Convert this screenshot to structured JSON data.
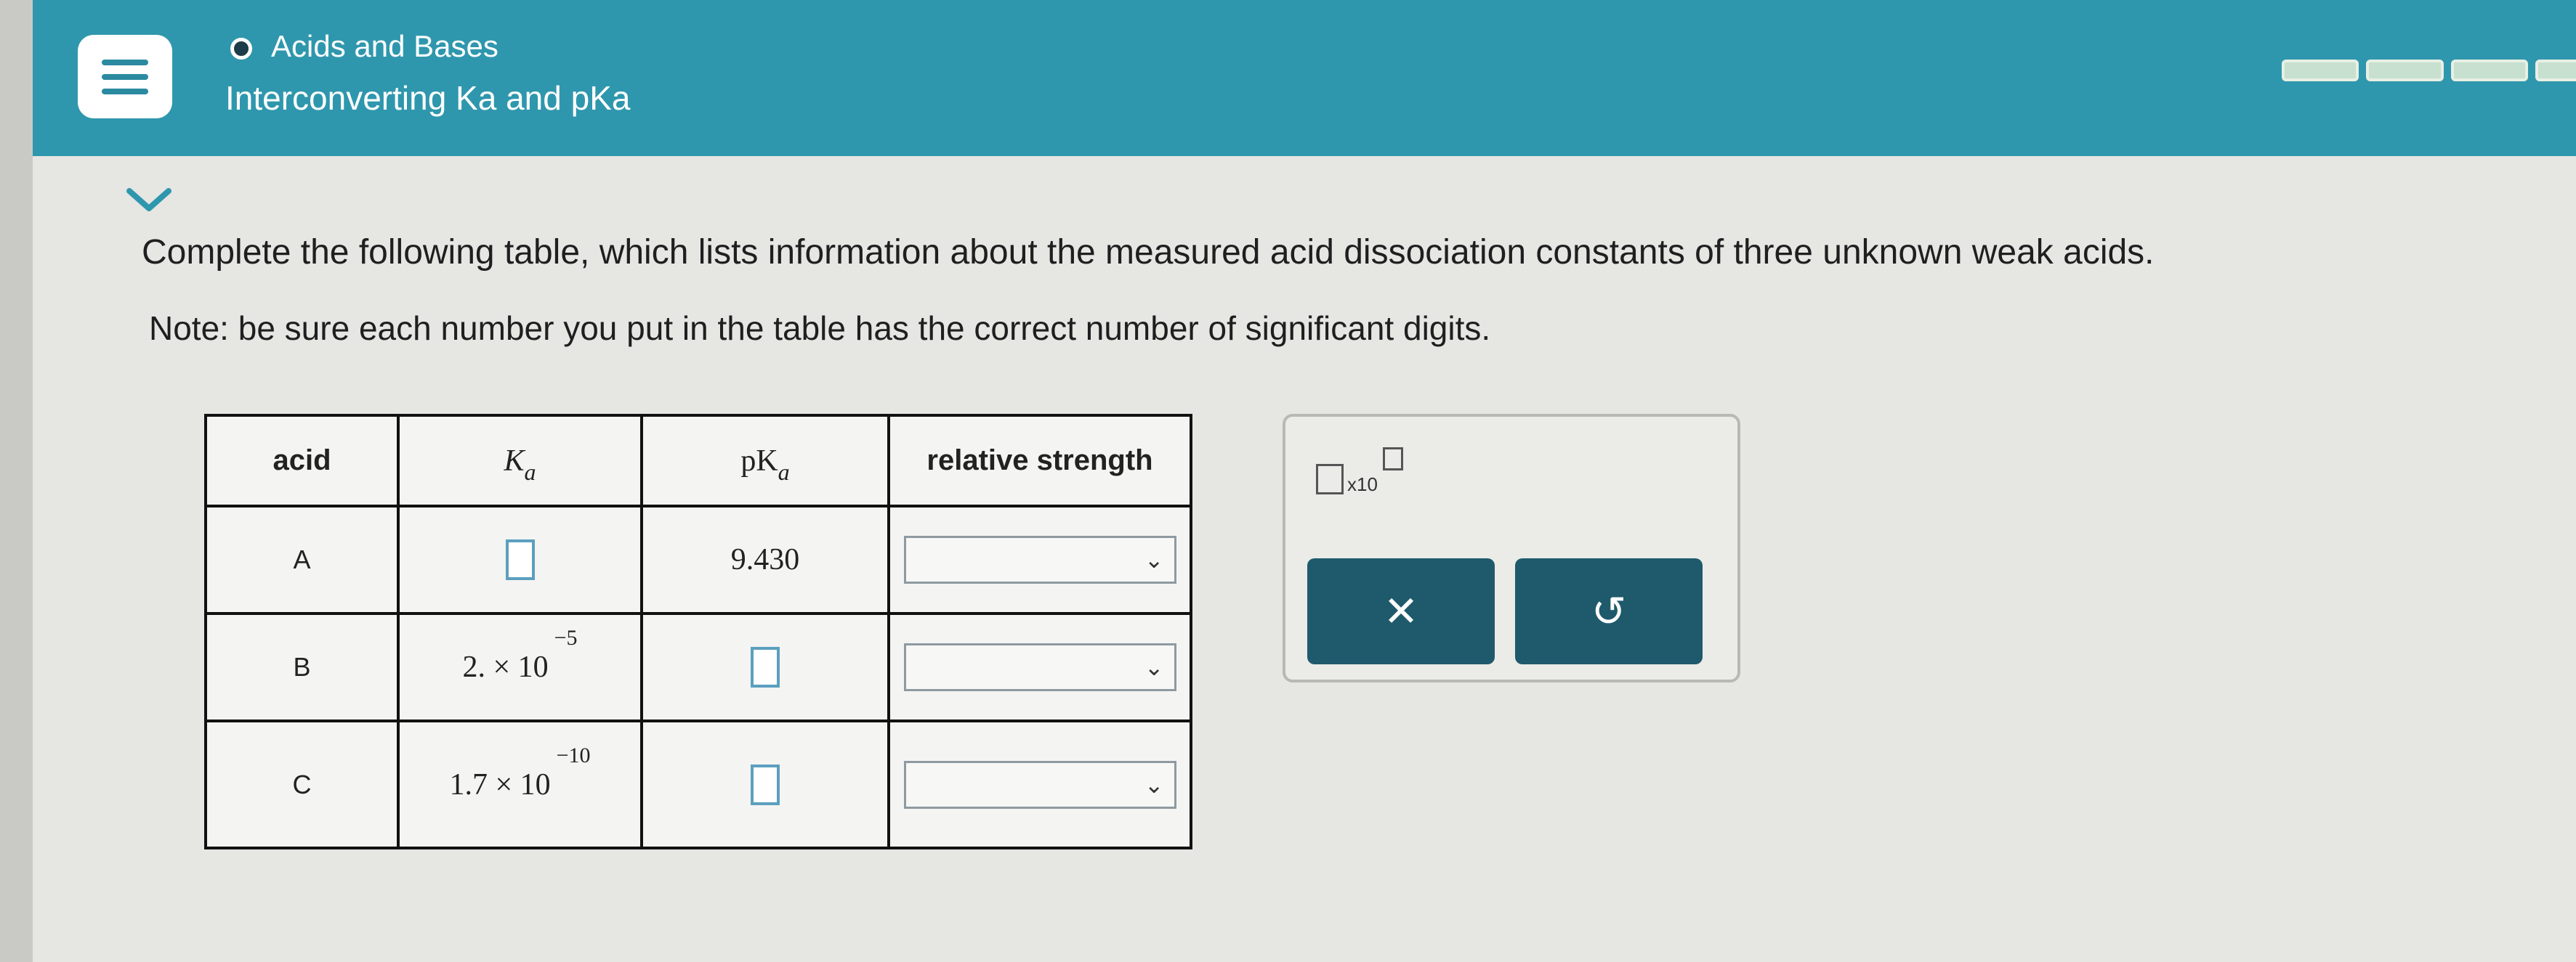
{
  "header": {
    "topic": "Acids and Bases",
    "subtitle": "Interconverting Ka and pKa"
  },
  "question": {
    "prompt": "Complete the following table, which lists information about the measured acid dissociation constants of three unknown weak acids.",
    "note_label": "Note:",
    "note_text": " be sure each number you put in the table has the correct number of significant digits."
  },
  "table": {
    "headers": {
      "acid": "acid",
      "ka_main": "K",
      "ka_sub": "a",
      "pka_main": "pK",
      "pka_sub": "a",
      "strength": "relative strength"
    },
    "rows": [
      {
        "acid": "A",
        "pka": "9.430"
      },
      {
        "acid": "B",
        "ka_mantissa": "2. × 10",
        "ka_exp": "−5"
      },
      {
        "acid": "C",
        "ka_mantissa": "1.7 × 10",
        "ka_exp": "−10"
      }
    ]
  },
  "tools": {
    "sci_label": "x10",
    "clear_symbol": "✕",
    "undo_symbol": "↺"
  },
  "colors": {
    "header_bg": "#2f97ad",
    "button_bg": "#1e5a6b",
    "input_border": "#5b9fbf"
  }
}
